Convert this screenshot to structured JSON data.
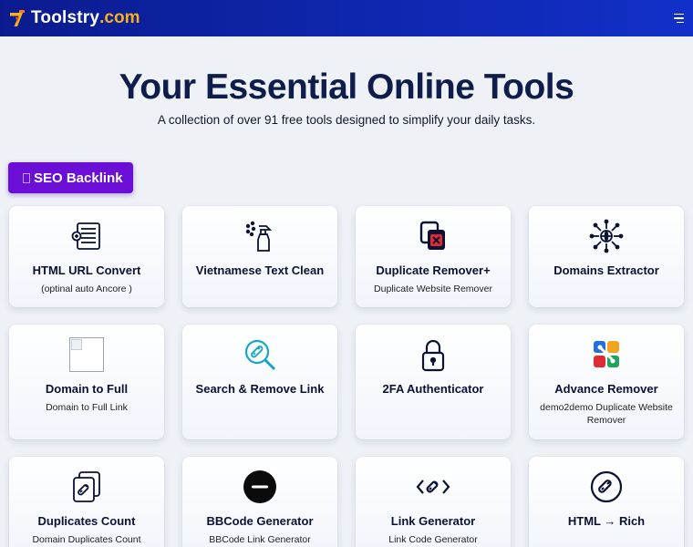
{
  "brand": {
    "logo_char": "7",
    "name": "Toolstry",
    "tld": ".com"
  },
  "hero": {
    "title": "Your Essential Online Tools",
    "subtitle": "A collection of over 91 free tools designed to simplify your daily tasks."
  },
  "seo_button": {
    "label": "SEO Backlink"
  },
  "tools": [
    {
      "title": "HTML URL Convert",
      "desc": "(optinal auto Ancore )",
      "icon": "html-document-icon"
    },
    {
      "title": "Vietnamese Text Clean",
      "desc": "",
      "icon": "spray-bottle-icon"
    },
    {
      "title": "Duplicate Remover+",
      "desc": "Duplicate Website Remover",
      "icon": "duplicate-remove-icon"
    },
    {
      "title": "Domains Extractor",
      "desc": "",
      "icon": "network-globe-icon"
    },
    {
      "title": "Domain to Full",
      "desc": "Domain to Full Link",
      "icon": "broken-image-icon"
    },
    {
      "title": "Search & Remove Link",
      "desc": "",
      "icon": "search-link-icon"
    },
    {
      "title": "2FA Authenticator",
      "desc": "",
      "icon": "padlock-icon"
    },
    {
      "title": "Advance Remover",
      "desc": "demo2demo Duplicate Website Remover",
      "icon": "colorful-blocks-icon"
    },
    {
      "title": "Duplicates Count",
      "desc": "Domain Duplicates Count",
      "icon": "stacked-links-icon"
    },
    {
      "title": "BBCode Generator",
      "desc": "BBCode Link Generator",
      "icon": "minus-circle-icon"
    },
    {
      "title": "Link Generator",
      "desc": "Link Code Generator",
      "icon": "code-link-icon"
    },
    {
      "title": "HTML → Rich",
      "desc": "",
      "icon": "link-circle-icon"
    }
  ],
  "colors": {
    "header_start": "#0b1b8f",
    "header_end": "#1230c9",
    "tld": "#f6b11a",
    "seo_button": "#6b0fd6",
    "page_bg": "#eef2f7",
    "title": "#0f1d4a",
    "search_icon": "#14a8c4"
  }
}
